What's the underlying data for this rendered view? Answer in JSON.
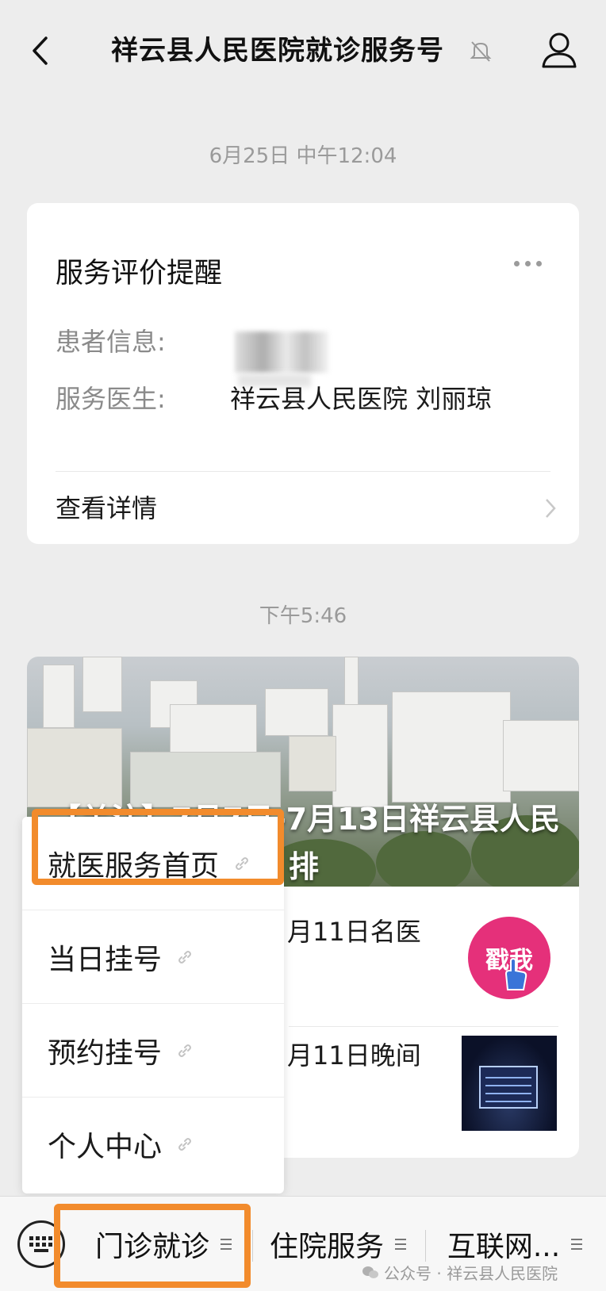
{
  "header": {
    "title": "祥云县人民医院就诊服务号"
  },
  "timestamps": {
    "first": "6月25日 中午12:04",
    "second": "下午5:46"
  },
  "service_card": {
    "title": "服务评价提醒",
    "patient_label": "患者信息:",
    "doctor_label": "服务医生:",
    "doctor_value": "祥云县人民医院 刘丽琼",
    "detail_link": "查看详情"
  },
  "article_card": {
    "hero_title": "【关注】7月7日-7月13日祥云县人民",
    "hero_sub": "排",
    "items": [
      {
        "text": "月11日名医",
        "thumb_label": "戳我"
      },
      {
        "text": "月11日晚间"
      }
    ]
  },
  "popup_menu": {
    "items": [
      {
        "label": "就医服务首页"
      },
      {
        "label": "当日挂号"
      },
      {
        "label": "预约挂号"
      },
      {
        "label": "个人中心"
      }
    ]
  },
  "bottom_menu": {
    "tabs": [
      {
        "label": "门诊就诊"
      },
      {
        "label": "住院服务"
      },
      {
        "label": "互联网..."
      }
    ]
  },
  "watermark": "公众号 · 祥云县人民医院",
  "colors": {
    "highlight": "#f28b2c",
    "background": "#ededed"
  }
}
